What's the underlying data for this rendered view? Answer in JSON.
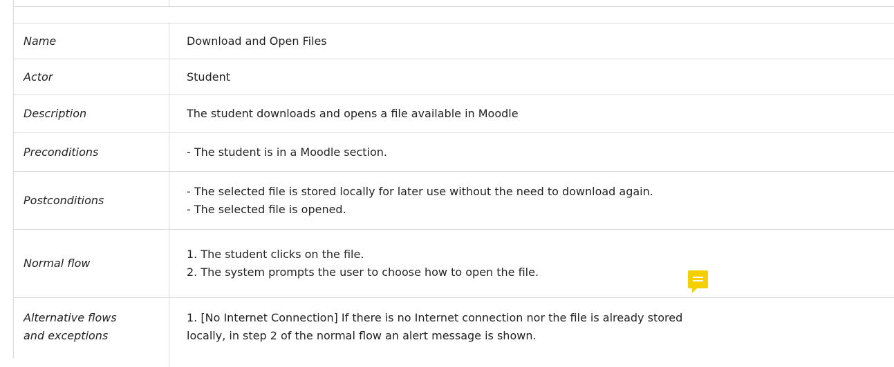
{
  "table": {
    "rows": [
      {
        "label": "Name",
        "values": [
          "Download and Open Files"
        ]
      },
      {
        "label": "Actor",
        "values": [
          "Student"
        ]
      },
      {
        "label": "Description",
        "values": [
          "The student downloads and opens a file available in Moodle"
        ]
      },
      {
        "label": "Preconditions",
        "values": [
          "- The student is in a Moodle section."
        ]
      },
      {
        "label": "Postconditions",
        "values": [
          "- The selected file is stored locally for later use without the need to download again.",
          "- The selected file is opened."
        ]
      },
      {
        "label": "Normal flow",
        "values": [
          "1. The student clicks on the file.",
          "2. The system prompts the user to choose how to open the file."
        ]
      },
      {
        "label_lines": [
          "Alternative flows",
          "and exceptions"
        ],
        "values": [
          "1. [No Internet Connection] If there is no Internet connection nor the file is already stored",
          "locally, in step 2 of the normal flow an alert message is shown."
        ]
      }
    ]
  },
  "comment": {
    "icon": "comment-icon",
    "color": "#f5cf00"
  }
}
